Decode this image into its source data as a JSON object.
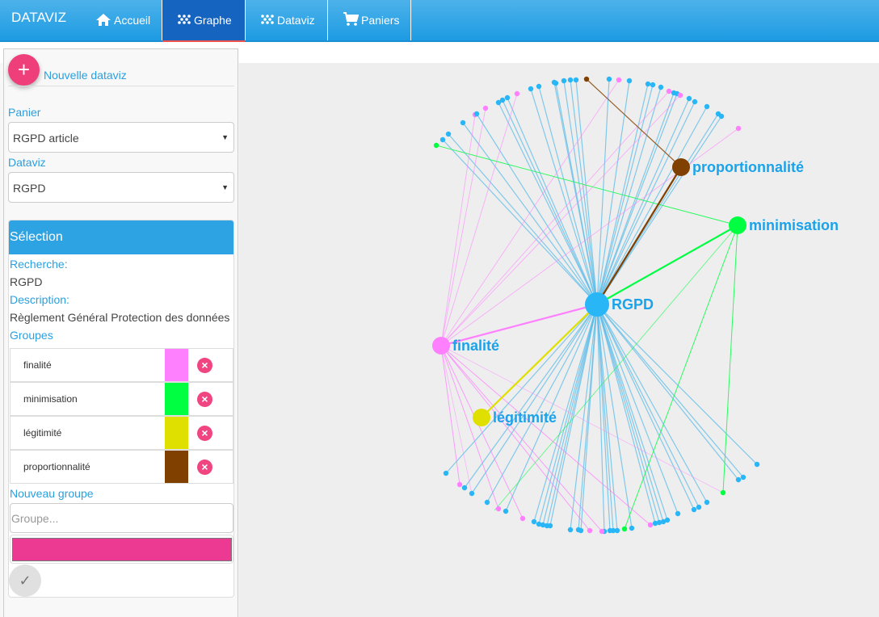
{
  "navbar": {
    "brand": "DATAVIZ",
    "items": [
      {
        "label": "Accueil",
        "icon": "home-icon",
        "active": false
      },
      {
        "label": "Graphe",
        "icon": "graph-icon",
        "active": true
      },
      {
        "label": "Dataviz",
        "icon": "graph-icon",
        "active": false
      },
      {
        "label": "Paniers",
        "icon": "cart-icon",
        "active": false
      }
    ]
  },
  "sidebar": {
    "new_button": "+",
    "new_label": "Nouvelle dataviz",
    "panier_label": "Panier",
    "panier_value": "RGPD article",
    "dataviz_label": "Dataviz",
    "dataviz_value": "RGPD",
    "selection": {
      "title": "Sélection",
      "recherche_label": "Recherche:",
      "recherche_value": "RGPD",
      "description_label": "Description:",
      "description_value": "Règlement Général Protection des données",
      "groupes_label": "Groupes",
      "groups": [
        {
          "name": "finalité",
          "color": "#ff80ff"
        },
        {
          "name": "minimisation",
          "color": "#00ff40"
        },
        {
          "name": "légitimité",
          "color": "#dfe000"
        },
        {
          "name": "proportionnalité",
          "color": "#804000"
        }
      ],
      "new_group_label": "Nouveau groupe",
      "new_group_placeholder": "Groupe...",
      "new_group_color": "#ec3a92",
      "confirm_icon": "✓"
    }
  },
  "graph": {
    "colors": {
      "doc": "#29b6f6",
      "finalite": "#ff80ff",
      "minimisation": "#00ff40",
      "legitimite": "#dfe000",
      "proportionnalite": "#804000"
    },
    "hubs": [
      {
        "id": "rgpd",
        "label": "RGPD",
        "group": "doc"
      },
      {
        "id": "finalite",
        "label": "finalité",
        "group": "finalite"
      },
      {
        "id": "minimisation",
        "label": "minimisation",
        "group": "minimisation"
      },
      {
        "id": "legitimite",
        "label": "légitimité",
        "group": "legitimite"
      },
      {
        "id": "proportionnalite",
        "label": "proportionnalité",
        "group": "proportionnalite"
      }
    ]
  }
}
